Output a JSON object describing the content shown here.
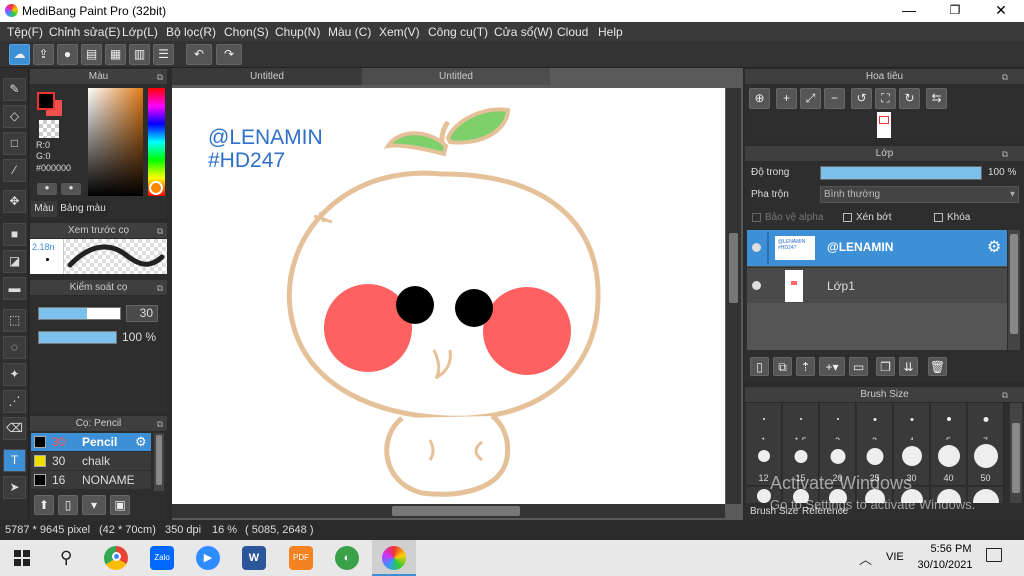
{
  "window": {
    "title": "MediBang Paint Pro (32bit)",
    "min": "—",
    "max": "❐",
    "close": "✕"
  },
  "menu": [
    "Tệp(F)",
    "Chỉnh sửa(E)",
    "Lớp(L)",
    "Bộ lọc(R)",
    "Chọn(S)",
    "Chụp(N)",
    "Màu (C)",
    "Xem(V)",
    "Công cụ(T)",
    "Cửa sổ(W)",
    "Cloud",
    "Help"
  ],
  "color_panel": {
    "title": "Màu",
    "r": "R:0",
    "g": "G:0",
    "hex": "#000000",
    "tabs": [
      "Màu",
      "Bảng màu"
    ]
  },
  "brush_preview": {
    "title": "Xem trước cọ",
    "size": "2.18n"
  },
  "brush_control": {
    "title": "Kiểm soát cọ",
    "size_value": "30",
    "opacity_value": "100 %",
    "size_fraction": 0.59,
    "opacity_fraction": 1.0
  },
  "brush_list": {
    "title": "Cọ: Pencil",
    "items": [
      {
        "size": "30",
        "name": "Pencil",
        "color": "#000000"
      },
      {
        "size": "30",
        "name": "chalk",
        "color": "#f0e000"
      },
      {
        "size": "16",
        "name": "NONAME",
        "color": "#000000"
      }
    ]
  },
  "doc_tabs": [
    "Untitled",
    "Untitled"
  ],
  "artwork": {
    "line1": "@LENAMIN",
    "line2": "#HD247"
  },
  "navigator": {
    "title": "Hoa tiêu"
  },
  "layer_panel": {
    "title": "Lớp",
    "opacity_label": "Độ trong",
    "opacity_value": "100 %",
    "opacity_fraction": 1.0,
    "blend_label": "Pha trộn",
    "blend_value": "Bình thường",
    "protect_alpha": "Bảo vệ alpha",
    "clipping": "Xén bớt",
    "lock": "Khóa",
    "layers": [
      {
        "name": "@LENAMIN",
        "thumb_text": "@LENAMIN #HD247"
      },
      {
        "name": "Lớp1"
      }
    ]
  },
  "brush_size": {
    "title": "Brush Size",
    "row1": [
      "1",
      "1.5",
      "2",
      "3",
      "4",
      "5",
      "7"
    ],
    "row2": [
      "12",
      "15",
      "20",
      "25",
      "30",
      "40",
      "50"
    ],
    "footer": [
      "Brush Size",
      "Reference"
    ]
  },
  "watermark": {
    "line1": "Activate Windows",
    "line2": "Go to Settings to activate Windows."
  },
  "status": {
    "pixel_size": "5787 * 9645 pixel",
    "cm_size": "(42 * 70cm)",
    "dpi": "350 dpi",
    "zoom": "16 %",
    "coords": "( 5085, 2648 )"
  },
  "taskbar": {
    "lang": "VIE",
    "time": "5:56 PM",
    "date": "30/10/2021",
    "icons": [
      "windows-start-icon",
      "search-icon",
      "chrome-icon",
      "zalo-icon",
      "zoom-icon",
      "word-icon",
      "pdf-icon",
      "app-icon",
      "medibang-icon"
    ],
    "zalo_label": "Zalo",
    "word_label": "W",
    "pdf_label": "PDF"
  }
}
